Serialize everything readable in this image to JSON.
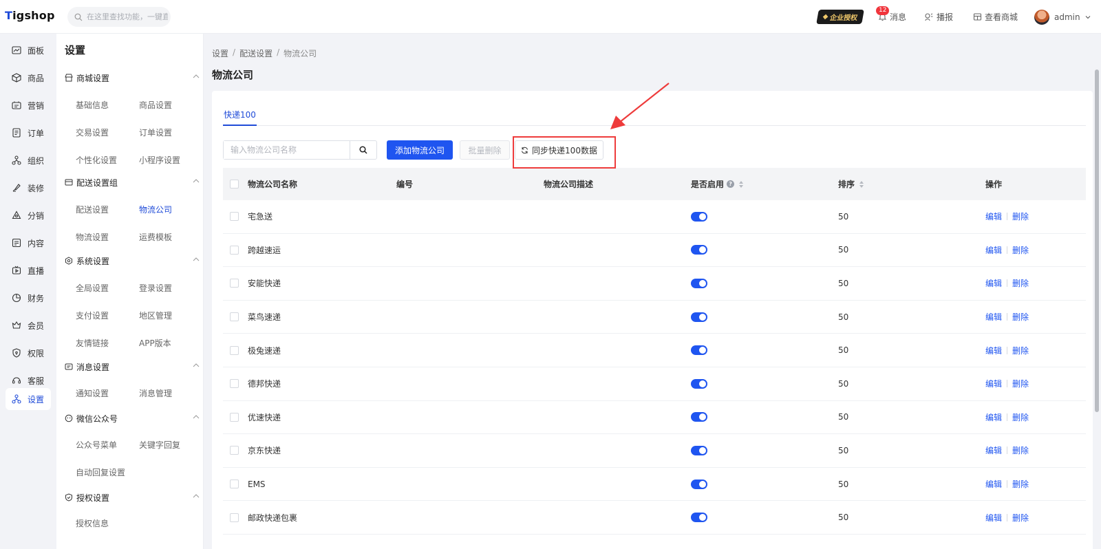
{
  "topbar": {
    "logo": "Tigshop",
    "search_placeholder": "在这里查找功能，一键直达",
    "enterprise_badge": "企业授权",
    "messages_label": "消息",
    "messages_count": "12",
    "broadcast_label": "播报",
    "view_store_label": "查看商城",
    "user_name": "admin"
  },
  "leftnav": {
    "items": [
      {
        "label": "面板",
        "icon": "dashboard-icon"
      },
      {
        "label": "商品",
        "icon": "box-icon"
      },
      {
        "label": "营销",
        "icon": "marketing-icon"
      },
      {
        "label": "订单",
        "icon": "order-icon"
      },
      {
        "label": "组织",
        "icon": "organization-icon"
      },
      {
        "label": "装修",
        "icon": "decorate-icon"
      },
      {
        "label": "分销",
        "icon": "distribution-icon"
      },
      {
        "label": "内容",
        "icon": "content-icon"
      },
      {
        "label": "直播",
        "icon": "live-icon"
      },
      {
        "label": "财务",
        "icon": "finance-icon"
      },
      {
        "label": "会员",
        "icon": "member-icon"
      },
      {
        "label": "权限",
        "icon": "permission-icon"
      },
      {
        "label": "客服",
        "icon": "service-icon"
      },
      {
        "label": "设置",
        "icon": "settings-icon",
        "active": true
      }
    ]
  },
  "subnav": {
    "title": "设置",
    "groups": [
      {
        "title": "商城设置",
        "links": [
          "基础信息",
          "商品设置",
          "交易设置",
          "订单设置",
          "个性化设置",
          "小程序设置"
        ]
      },
      {
        "title": "配送设置组",
        "links": [
          "配送设置",
          "物流公司",
          "物流设置",
          "运费模板"
        ]
      },
      {
        "title": "系统设置",
        "links": [
          "全局设置",
          "登录设置",
          "支付设置",
          "地区管理",
          "友情链接",
          "APP版本"
        ]
      },
      {
        "title": "消息设置",
        "links": [
          "通知设置",
          "消息管理"
        ]
      },
      {
        "title": "微信公众号",
        "links": [
          "公众号菜单",
          "关键字回复",
          "自动回复设置"
        ]
      },
      {
        "title": "授权设置",
        "links": [
          "授权信息"
        ]
      }
    ],
    "active_link": "物流公司"
  },
  "main": {
    "breadcrumb": [
      "设置",
      "配送设置",
      "物流公司"
    ],
    "page_title": "物流公司",
    "tab": "快递100",
    "search_placeholder": "输入物流公司名称",
    "add_button": "添加物流公司",
    "batch_delete_button": "批量删除",
    "sync_button": "同步快递100数据",
    "table": {
      "headers": [
        "物流公司名称",
        "编号",
        "物流公司描述",
        "是否启用",
        "排序",
        "操作"
      ],
      "edit_label": "编辑",
      "delete_label": "删除",
      "rows": [
        {
          "name": "宅急送",
          "code": "",
          "desc": "",
          "enabled": true,
          "sort": "50"
        },
        {
          "name": "跨越速运",
          "code": "",
          "desc": "",
          "enabled": true,
          "sort": "50"
        },
        {
          "name": "安能快递",
          "code": "",
          "desc": "",
          "enabled": true,
          "sort": "50"
        },
        {
          "name": "菜鸟速递",
          "code": "",
          "desc": "",
          "enabled": true,
          "sort": "50"
        },
        {
          "name": "极兔速递",
          "code": "",
          "desc": "",
          "enabled": true,
          "sort": "50"
        },
        {
          "name": "德邦快递",
          "code": "",
          "desc": "",
          "enabled": true,
          "sort": "50"
        },
        {
          "name": "优速快递",
          "code": "",
          "desc": "",
          "enabled": true,
          "sort": "50"
        },
        {
          "name": "京东快递",
          "code": "",
          "desc": "",
          "enabled": true,
          "sort": "50"
        },
        {
          "name": "EMS",
          "code": "",
          "desc": "",
          "enabled": true,
          "sort": "50"
        },
        {
          "name": "邮政快递包裹",
          "code": "",
          "desc": "",
          "enabled": true,
          "sort": "50"
        }
      ]
    }
  },
  "colors": {
    "primary": "#1f55f0",
    "annotation_red": "#ee3b3b",
    "sidebar_bg": "#f2f3f7"
  }
}
